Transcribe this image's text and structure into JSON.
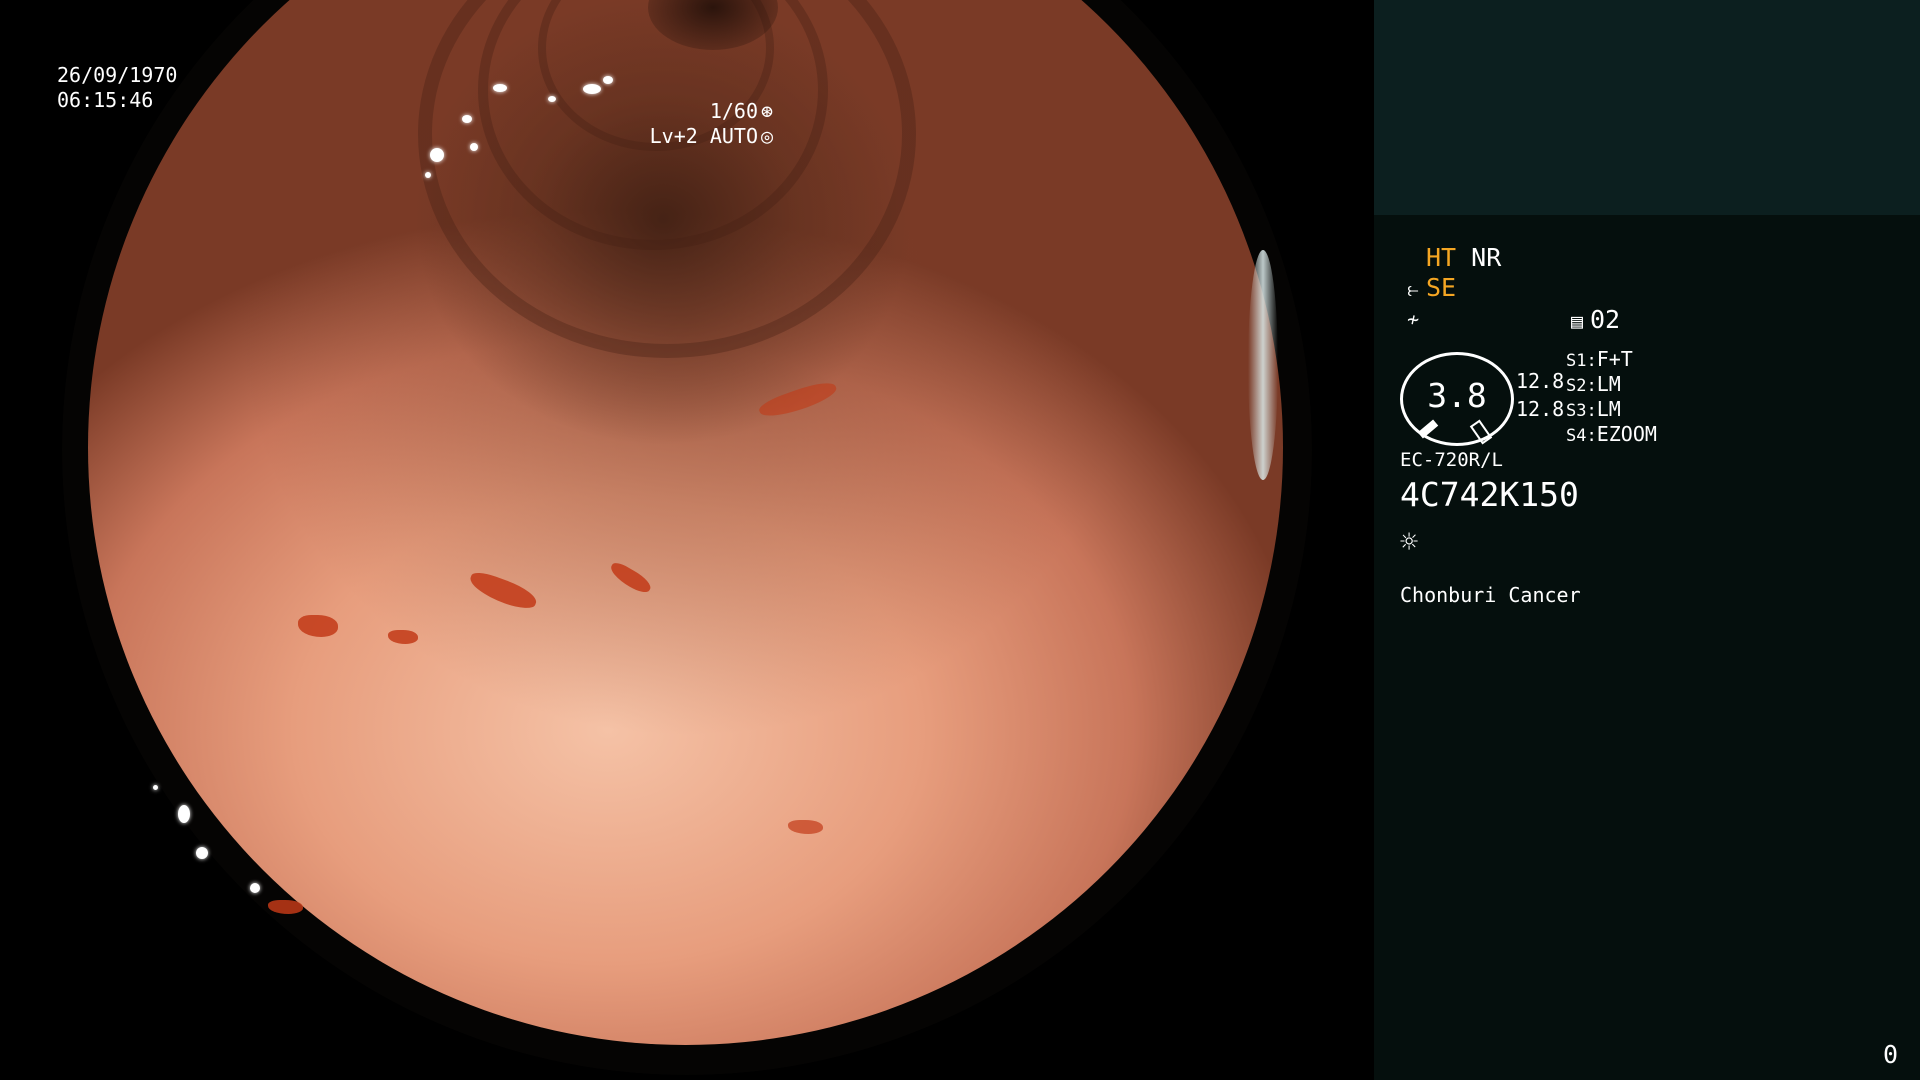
{
  "image": {
    "date": "26/09/1970",
    "time": "06:15:46",
    "shutter": "1/60",
    "shutter_icon": "shutter-icon",
    "iris": "Lv+2 AUTO",
    "iris_icon": "iris-icon"
  },
  "panel": {
    "ht_label": "HT",
    "nr_label": "NR",
    "se_label": "SE",
    "se_icon": "structure-enhance-icon",
    "color_icon": "color-mode-icon",
    "memory_icon": "memory-card-icon",
    "memory_count": "02",
    "gauge_value": "3.8",
    "gauge_left_top": "12.8",
    "gauge_left_bottom": "12.8",
    "switches": [
      {
        "key": "S1:",
        "value": "F+T"
      },
      {
        "key": "S2:",
        "value": "LM"
      },
      {
        "key": "S3:",
        "value": "LM"
      },
      {
        "key": "S4:",
        "value": "EZOOM"
      }
    ],
    "scope_model": "EC-720R/L",
    "scope_serial": "4C742K150",
    "light_icon": "light-source-icon",
    "site": "Chonburi Cancer",
    "frame_counter": "0"
  },
  "colors": {
    "panel_bg": "#050f0d",
    "panel_top_bg": "#0c1f1f",
    "highlight": "#f5a623",
    "text": "#ffffff"
  }
}
